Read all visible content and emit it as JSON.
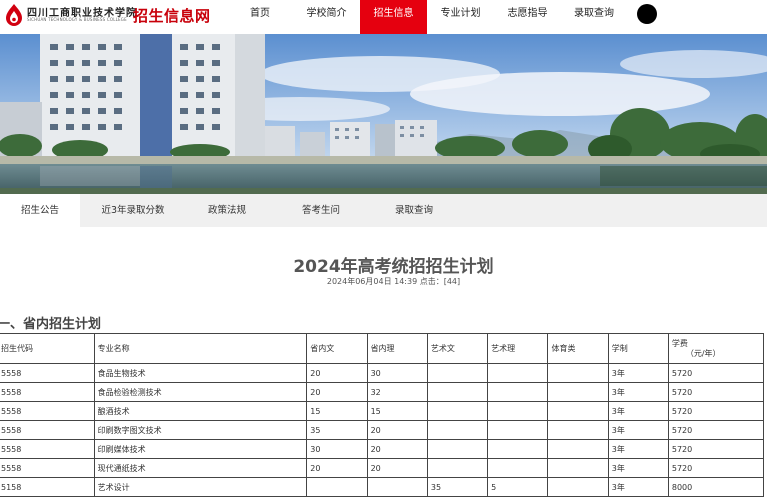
{
  "header": {
    "school_name": "四川工商职业技术学院",
    "school_name_en": "SICHUAN TECHNOLOGY & BUSINESS COLLEGE",
    "site_title": "招生信息网"
  },
  "nav": {
    "items": [
      {
        "label": "首页",
        "active": false
      },
      {
        "label": "学校简介",
        "active": false
      },
      {
        "label": "招生信息",
        "active": true
      },
      {
        "label": "专业计划",
        "active": false
      },
      {
        "label": "志愿指导",
        "active": false
      },
      {
        "label": "录取查询",
        "active": false
      }
    ]
  },
  "subtabs": {
    "items": [
      {
        "label": "招生公告",
        "active": true
      },
      {
        "label": "近3年录取分数",
        "active": false
      },
      {
        "label": "政策法规",
        "active": false
      },
      {
        "label": "答考生问",
        "active": false
      },
      {
        "label": "录取查询",
        "active": false
      }
    ]
  },
  "article": {
    "title": "2024年高考统招招生计划",
    "meta": "2024年06月04日 14:39  点击：[44]",
    "section_heading": "一、省内招生计划"
  },
  "table": {
    "headers": [
      "招生代码",
      "专业名称",
      "省内文",
      "省内理",
      "艺术文",
      "艺术理",
      "体育类",
      "学制",
      "学费",
      "（元/年）"
    ],
    "rows": [
      [
        "5558",
        "食品生物技术",
        "20",
        "30",
        "",
        "",
        "",
        "3年",
        "5720"
      ],
      [
        "5558",
        "食品检验检测技术",
        "20",
        "32",
        "",
        "",
        "",
        "3年",
        "5720"
      ],
      [
        "5558",
        "酿酒技术",
        "15",
        "15",
        "",
        "",
        "",
        "3年",
        "5720"
      ],
      [
        "5558",
        "印刷数字图文技术",
        "35",
        "20",
        "",
        "",
        "",
        "3年",
        "5720"
      ],
      [
        "5558",
        "印刷媒体技术",
        "30",
        "20",
        "",
        "",
        "",
        "3年",
        "5720"
      ],
      [
        "5558",
        "现代通纸技术",
        "20",
        "20",
        "",
        "",
        "",
        "3年",
        "5720"
      ],
      [
        "5158",
        "艺术设计",
        "",
        "",
        "35",
        "5",
        "",
        "3年",
        "8000"
      ]
    ]
  }
}
